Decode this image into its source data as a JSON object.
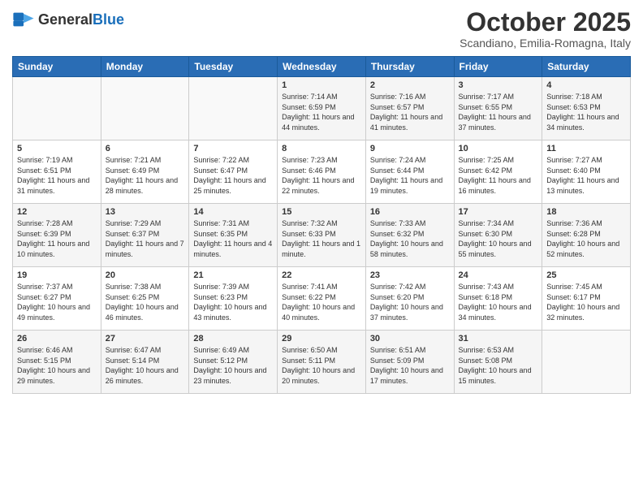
{
  "header": {
    "logo_general": "General",
    "logo_blue": "Blue",
    "month": "October 2025",
    "location": "Scandiano, Emilia-Romagna, Italy"
  },
  "days_of_week": [
    "Sunday",
    "Monday",
    "Tuesday",
    "Wednesday",
    "Thursday",
    "Friday",
    "Saturday"
  ],
  "weeks": [
    [
      {
        "day": "",
        "content": ""
      },
      {
        "day": "",
        "content": ""
      },
      {
        "day": "",
        "content": ""
      },
      {
        "day": "1",
        "content": "Sunrise: 7:14 AM\nSunset: 6:59 PM\nDaylight: 11 hours and 44 minutes."
      },
      {
        "day": "2",
        "content": "Sunrise: 7:16 AM\nSunset: 6:57 PM\nDaylight: 11 hours and 41 minutes."
      },
      {
        "day": "3",
        "content": "Sunrise: 7:17 AM\nSunset: 6:55 PM\nDaylight: 11 hours and 37 minutes."
      },
      {
        "day": "4",
        "content": "Sunrise: 7:18 AM\nSunset: 6:53 PM\nDaylight: 11 hours and 34 minutes."
      }
    ],
    [
      {
        "day": "5",
        "content": "Sunrise: 7:19 AM\nSunset: 6:51 PM\nDaylight: 11 hours and 31 minutes."
      },
      {
        "day": "6",
        "content": "Sunrise: 7:21 AM\nSunset: 6:49 PM\nDaylight: 11 hours and 28 minutes."
      },
      {
        "day": "7",
        "content": "Sunrise: 7:22 AM\nSunset: 6:47 PM\nDaylight: 11 hours and 25 minutes."
      },
      {
        "day": "8",
        "content": "Sunrise: 7:23 AM\nSunset: 6:46 PM\nDaylight: 11 hours and 22 minutes."
      },
      {
        "day": "9",
        "content": "Sunrise: 7:24 AM\nSunset: 6:44 PM\nDaylight: 11 hours and 19 minutes."
      },
      {
        "day": "10",
        "content": "Sunrise: 7:25 AM\nSunset: 6:42 PM\nDaylight: 11 hours and 16 minutes."
      },
      {
        "day": "11",
        "content": "Sunrise: 7:27 AM\nSunset: 6:40 PM\nDaylight: 11 hours and 13 minutes."
      }
    ],
    [
      {
        "day": "12",
        "content": "Sunrise: 7:28 AM\nSunset: 6:39 PM\nDaylight: 11 hours and 10 minutes."
      },
      {
        "day": "13",
        "content": "Sunrise: 7:29 AM\nSunset: 6:37 PM\nDaylight: 11 hours and 7 minutes."
      },
      {
        "day": "14",
        "content": "Sunrise: 7:31 AM\nSunset: 6:35 PM\nDaylight: 11 hours and 4 minutes."
      },
      {
        "day": "15",
        "content": "Sunrise: 7:32 AM\nSunset: 6:33 PM\nDaylight: 11 hours and 1 minute."
      },
      {
        "day": "16",
        "content": "Sunrise: 7:33 AM\nSunset: 6:32 PM\nDaylight: 10 hours and 58 minutes."
      },
      {
        "day": "17",
        "content": "Sunrise: 7:34 AM\nSunset: 6:30 PM\nDaylight: 10 hours and 55 minutes."
      },
      {
        "day": "18",
        "content": "Sunrise: 7:36 AM\nSunset: 6:28 PM\nDaylight: 10 hours and 52 minutes."
      }
    ],
    [
      {
        "day": "19",
        "content": "Sunrise: 7:37 AM\nSunset: 6:27 PM\nDaylight: 10 hours and 49 minutes."
      },
      {
        "day": "20",
        "content": "Sunrise: 7:38 AM\nSunset: 6:25 PM\nDaylight: 10 hours and 46 minutes."
      },
      {
        "day": "21",
        "content": "Sunrise: 7:39 AM\nSunset: 6:23 PM\nDaylight: 10 hours and 43 minutes."
      },
      {
        "day": "22",
        "content": "Sunrise: 7:41 AM\nSunset: 6:22 PM\nDaylight: 10 hours and 40 minutes."
      },
      {
        "day": "23",
        "content": "Sunrise: 7:42 AM\nSunset: 6:20 PM\nDaylight: 10 hours and 37 minutes."
      },
      {
        "day": "24",
        "content": "Sunrise: 7:43 AM\nSunset: 6:18 PM\nDaylight: 10 hours and 34 minutes."
      },
      {
        "day": "25",
        "content": "Sunrise: 7:45 AM\nSunset: 6:17 PM\nDaylight: 10 hours and 32 minutes."
      }
    ],
    [
      {
        "day": "26",
        "content": "Sunrise: 6:46 AM\nSunset: 5:15 PM\nDaylight: 10 hours and 29 minutes."
      },
      {
        "day": "27",
        "content": "Sunrise: 6:47 AM\nSunset: 5:14 PM\nDaylight: 10 hours and 26 minutes."
      },
      {
        "day": "28",
        "content": "Sunrise: 6:49 AM\nSunset: 5:12 PM\nDaylight: 10 hours and 23 minutes."
      },
      {
        "day": "29",
        "content": "Sunrise: 6:50 AM\nSunset: 5:11 PM\nDaylight: 10 hours and 20 minutes."
      },
      {
        "day": "30",
        "content": "Sunrise: 6:51 AM\nSunset: 5:09 PM\nDaylight: 10 hours and 17 minutes."
      },
      {
        "day": "31",
        "content": "Sunrise: 6:53 AM\nSunset: 5:08 PM\nDaylight: 10 hours and 15 minutes."
      },
      {
        "day": "",
        "content": ""
      }
    ]
  ]
}
